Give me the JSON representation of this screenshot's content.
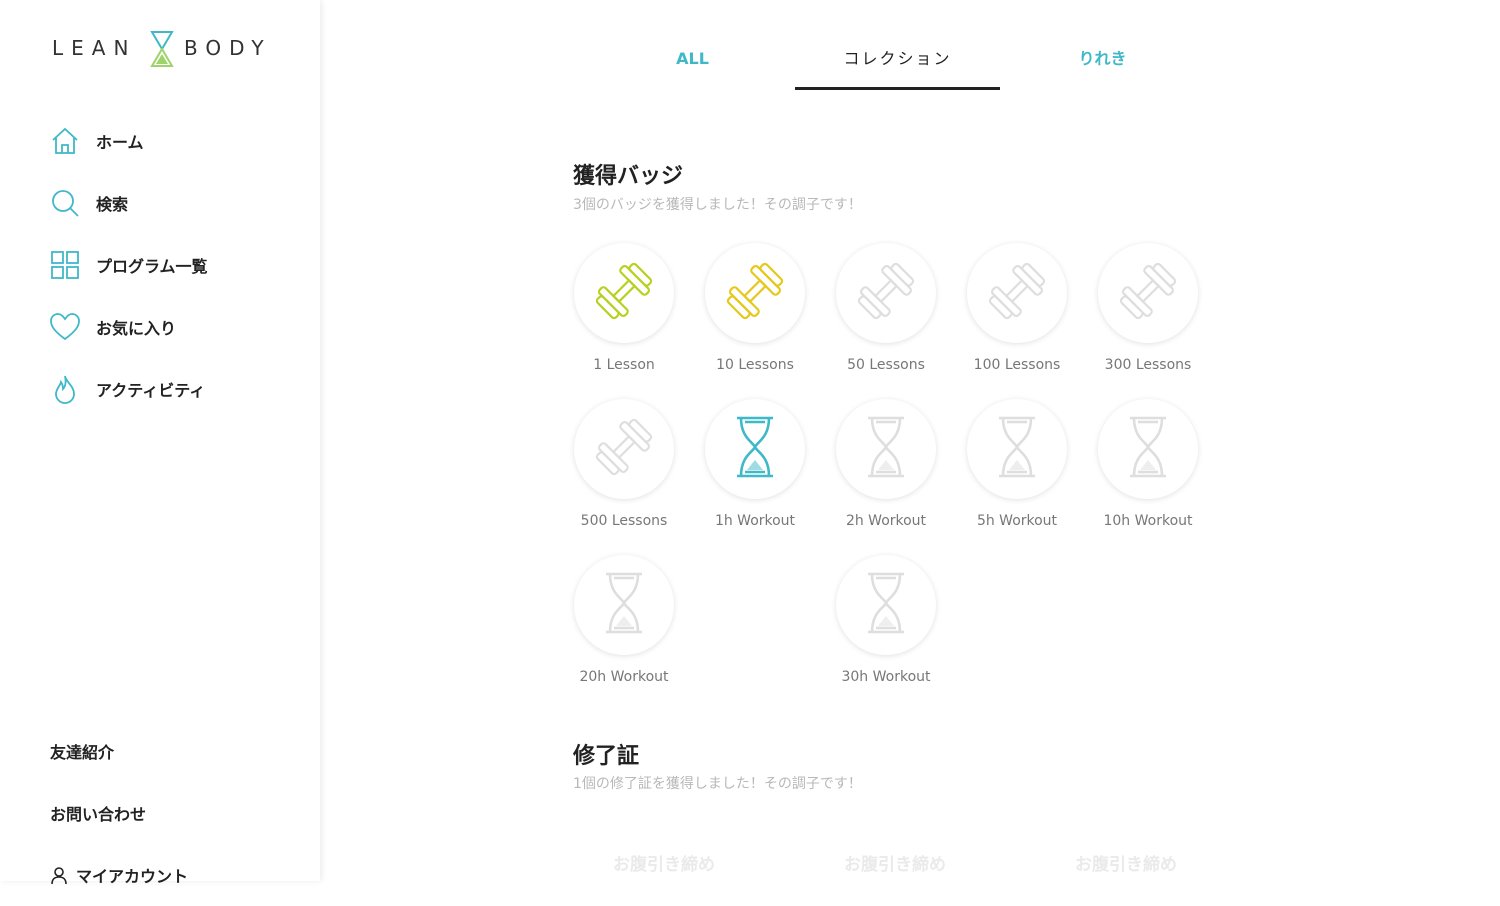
{
  "logo": {
    "left_word": "LEAN",
    "right_word": "BODY"
  },
  "sidebar": {
    "items": [
      {
        "label": "ホーム",
        "icon": "home-icon"
      },
      {
        "label": "検索",
        "icon": "search-icon"
      },
      {
        "label": "プログラム一覧",
        "icon": "grid-icon"
      },
      {
        "label": "お気に入り",
        "icon": "heart-icon"
      },
      {
        "label": "アクティビティ",
        "icon": "flame-icon"
      }
    ],
    "bottom": [
      {
        "label": "友達紹介"
      },
      {
        "label": "お問い合わせ"
      },
      {
        "label": "マイアカウント",
        "icon": "user-icon"
      }
    ]
  },
  "tabs": {
    "all": "ALL",
    "collection": "コレクション",
    "history": "りれき",
    "active": "collection"
  },
  "badges_section": {
    "title": "獲得バッジ",
    "subtitle": "3個のバッジを獲得しました！その調子です！",
    "badges": [
      {
        "label": "1 Lesson",
        "type": "dumbbell",
        "earned": true,
        "color": "#b8d11e"
      },
      {
        "label": "10 Lessons",
        "type": "dumbbell",
        "earned": true,
        "color": "#e6c81a"
      },
      {
        "label": "50 Lessons",
        "type": "dumbbell",
        "earned": false
      },
      {
        "label": "100 Lessons",
        "type": "dumbbell",
        "earned": false
      },
      {
        "label": "300 Lessons",
        "type": "dumbbell",
        "earned": false
      },
      {
        "label": "500 Lessons",
        "type": "dumbbell",
        "earned": false
      },
      {
        "label": "1h Workout",
        "type": "hourglass",
        "earned": true,
        "color": "#3fb8c8"
      },
      {
        "label": "2h Workout",
        "type": "hourglass",
        "earned": false
      },
      {
        "label": "5h Workout",
        "type": "hourglass",
        "earned": false
      },
      {
        "label": "10h Workout",
        "type": "hourglass",
        "earned": false
      },
      {
        "label": "20h Workout",
        "type": "hourglass",
        "earned": false
      },
      {
        "label": "30h Workout",
        "type": "hourglass",
        "earned": false
      }
    ]
  },
  "cert_section": {
    "title": "修了証",
    "subtitle": "1個の修了証を獲得しました！その調子です！",
    "certs": [
      "お腹引き締め",
      "お腹引き締め",
      "お腹引き締め"
    ]
  },
  "colors": {
    "accent": "#3fb8c8",
    "inactive": "#dedede"
  }
}
